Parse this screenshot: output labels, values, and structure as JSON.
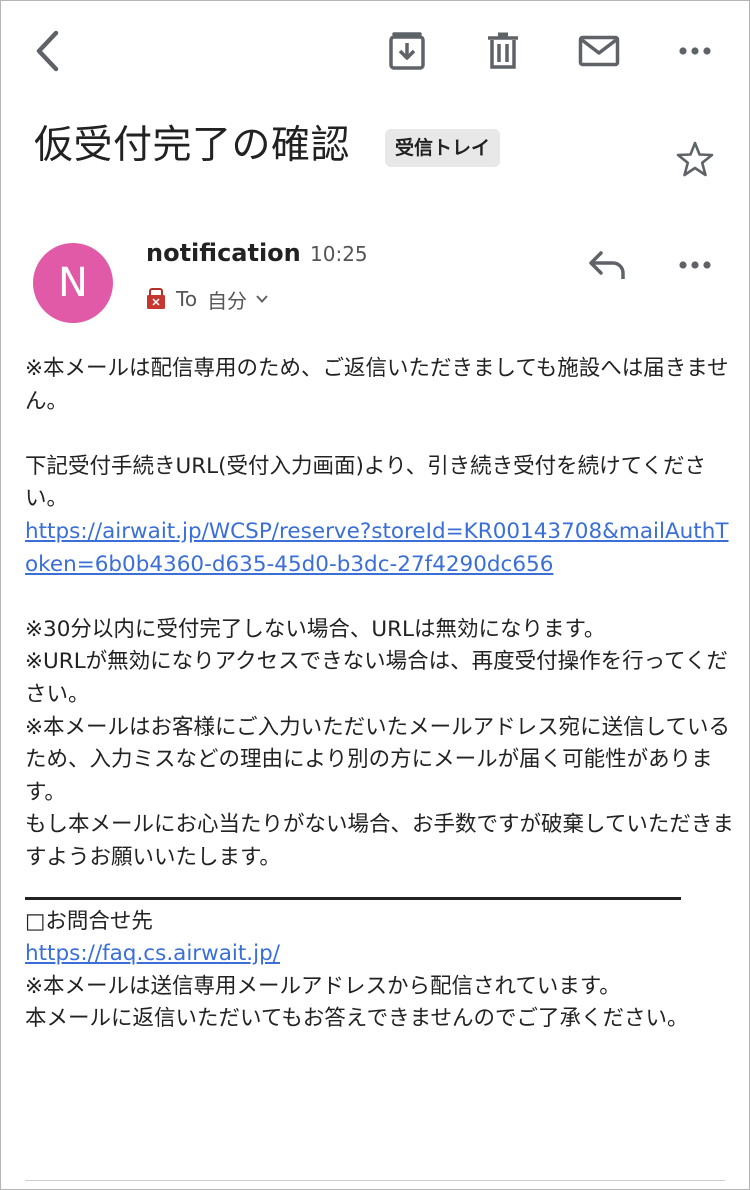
{
  "toolbar": {
    "back": "back-icon",
    "archive": "archive-icon",
    "delete": "trash-icon",
    "mark_unread": "mail-icon",
    "more": "more-icon"
  },
  "subject": {
    "title": "仮受付完了の確認",
    "label": "受信トレイ"
  },
  "message": {
    "avatar_letter": "N",
    "avatar_color": "#e05aa7",
    "sender": "notification",
    "time": "10:25",
    "to_label": "To",
    "recipient": "自分"
  },
  "body": {
    "p1": "※本メールは配信専用のため、ご返信いただきましても施設へは届きません。",
    "p2": "下記受付手続きURL(受付入力画面)より、引き続き受付を続けてください。",
    "link1": "https://airwait.jp/WCSP/reserve?storeId=KR00143708&mailAuthToken=6b0b4360-d635-45d0-b3dc-27f4290dc656",
    "p3": "※30分以内に受付完了しない場合、URLは無効になります。",
    "p4": "※URLが無効になりアクセスできない場合は、再度受付操作を行ってください。",
    "p5": "※本メールはお客様にご入力いただいたメールアドレス宛に送信しているため、入力ミスなどの理由により別の方にメールが届く可能性があります。",
    "p6": "もし本メールにお心当たりがない場合、お手数ですが破棄していただきますようお願いいたします。",
    "contact_title": "□お問合せ先",
    "link2": "https://faq.cs.airwait.jp/",
    "p7": "※本メールは送信専用メールアドレスから配信されています。",
    "p8": "本メールに返信いただいてもお答えできませんのでご了承ください。"
  },
  "colors": {
    "link": "#3a6fd8",
    "icon": "#5f6368",
    "label_bg": "#e8e8e8"
  }
}
